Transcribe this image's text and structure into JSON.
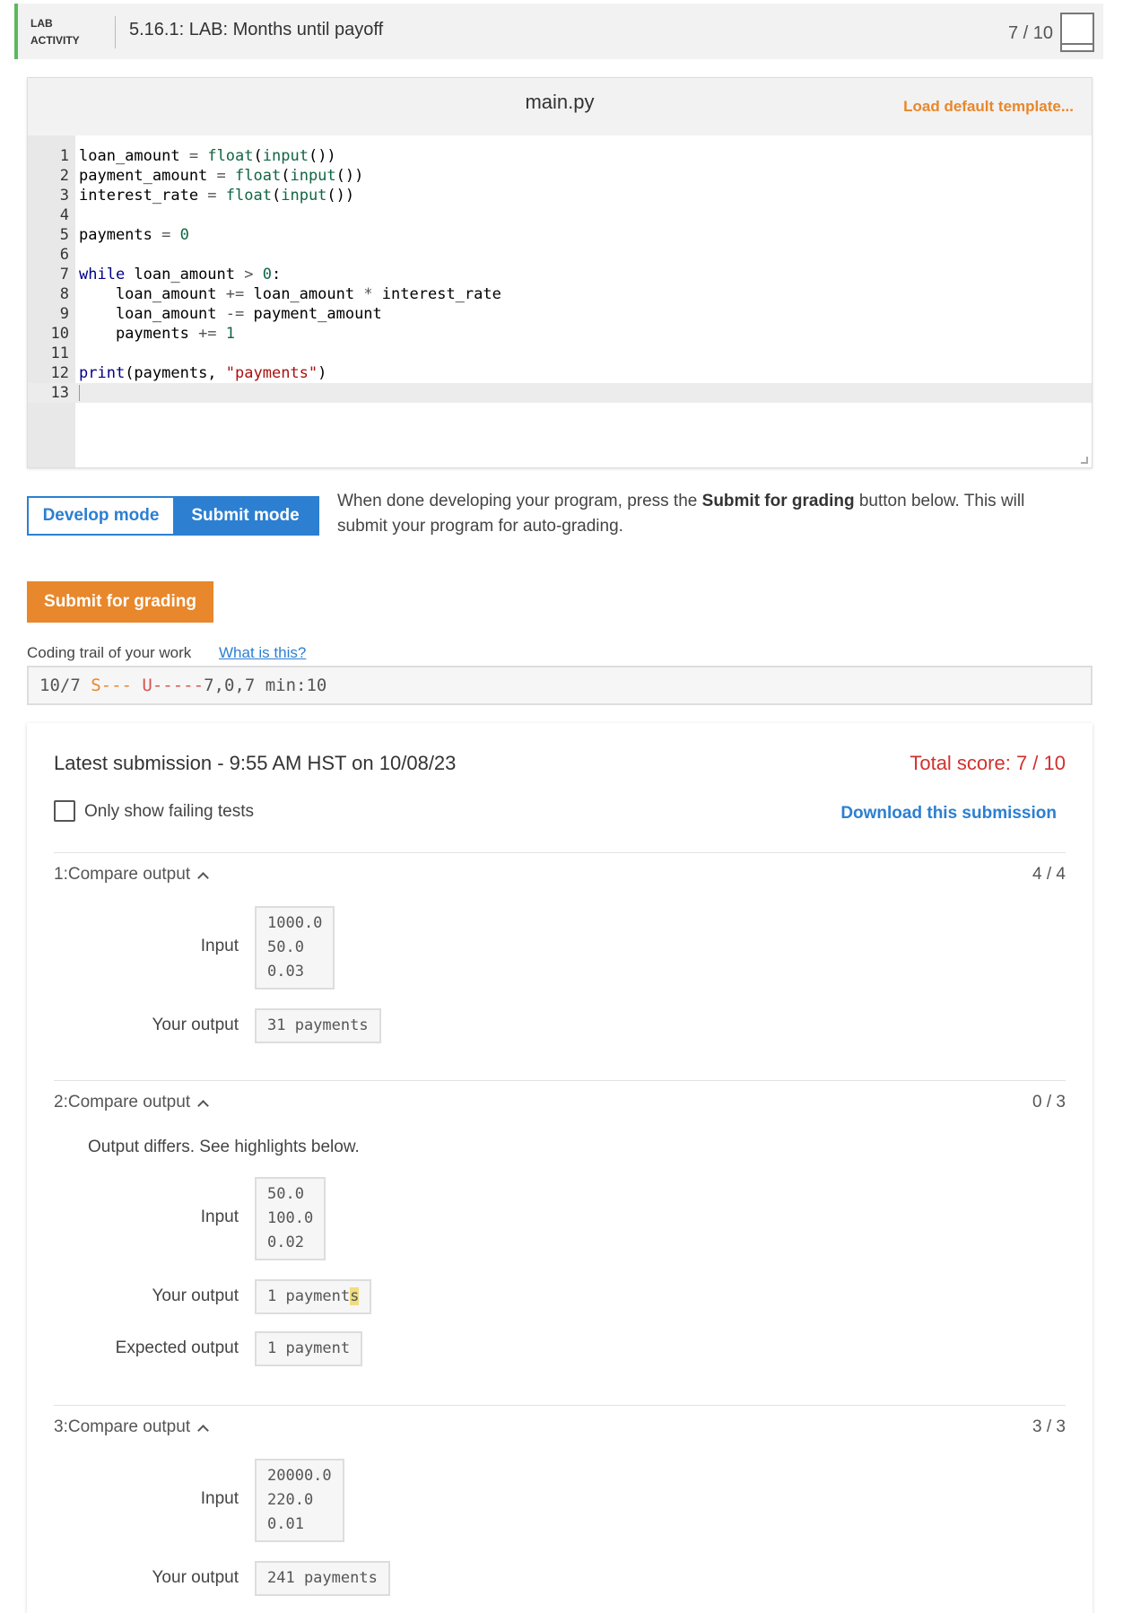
{
  "lab": {
    "tag_line1": "LAB",
    "tag_line2": "ACTIVITY",
    "title": "5.16.1: LAB: Months until payoff",
    "score": "7 / 10"
  },
  "editor": {
    "filename": "main.py",
    "load_template": "Load default template...",
    "lines": [
      "1",
      "2",
      "3",
      "4",
      "5",
      "6",
      "7",
      "8",
      "9",
      "10",
      "11",
      "12",
      "13"
    ]
  },
  "mode": {
    "develop": "Develop mode",
    "submit": "Submit mode",
    "desc_before": "When done developing your program, press the ",
    "desc_bold": "Submit for grading",
    "desc_after": " button below. This will submit your program for auto-grading."
  },
  "submit_grading": "Submit for grading",
  "trail": {
    "label": "Coding trail of your work",
    "link": "What is this?",
    "date": "10/7 ",
    "s_part": "S---",
    "space": " ",
    "u_part": "U-----",
    "rest": "7,0,7 min:10"
  },
  "submission": {
    "title": "Latest submission - 9:55 AM HST on 10/08/23",
    "total": "Total score: 7 / 10",
    "only_failing": "Only show failing tests",
    "download": "Download this submission",
    "tests": [
      {
        "title": "1:Compare output",
        "score": "4 / 4",
        "input_label": "Input",
        "input": "1000.0\n50.0\n0.03",
        "your_output_label": "Your output",
        "your_output": "31 payments"
      },
      {
        "title": "2:Compare output",
        "score": "0 / 3",
        "message": "Output differs. See highlights below.",
        "input_label": "Input",
        "input": "50.0\n100.0\n0.02",
        "your_output_label": "Your output",
        "your_output_a": "1 payment",
        "your_output_b": "s",
        "expected_label": "Expected output",
        "expected_output": "1 payment"
      },
      {
        "title": "3:Compare output",
        "score": "3 / 3",
        "input_label": "Input",
        "input": "20000.0\n220.0\n0.01",
        "your_output_label": "Your output",
        "your_output": "241 payments"
      }
    ]
  },
  "colors": {
    "accent_blue": "#2c7fd1",
    "accent_orange": "#e8872b",
    "score_red": "#d0312d",
    "lab_green": "#5cb85c"
  }
}
